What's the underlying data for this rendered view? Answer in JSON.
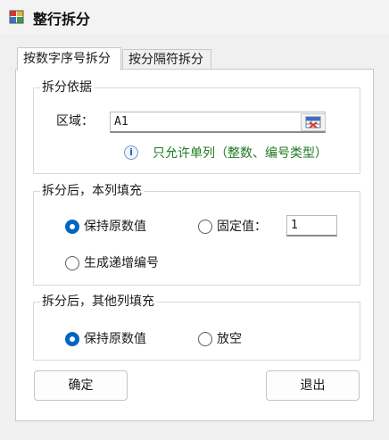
{
  "window": {
    "title": "整行拆分"
  },
  "tabs": [
    {
      "label": "按数字序号拆分",
      "active": true
    },
    {
      "label": "按分隔符拆分",
      "active": false
    }
  ],
  "basis": {
    "title": "拆分依据",
    "area_label": "区域：",
    "area_value": "A1",
    "info_glyph": "i",
    "hint": "只允许单列（整数、编号类型）"
  },
  "this_column": {
    "title": "拆分后，本列填充",
    "options": [
      {
        "label": "保持原数值",
        "checked": true
      },
      {
        "label": "固定值：",
        "checked": false
      },
      {
        "label": "生成递增编号",
        "checked": false
      }
    ],
    "fixed_value": "1"
  },
  "other_columns": {
    "title": "拆分后，其他列填充",
    "options": [
      {
        "label": "保持原数值",
        "checked": true
      },
      {
        "label": "放空",
        "checked": false
      }
    ]
  },
  "buttons": {
    "ok": "确定",
    "exit": "退出"
  },
  "colors": {
    "accent": "#0067c0",
    "hint": "#1f7a1f"
  }
}
